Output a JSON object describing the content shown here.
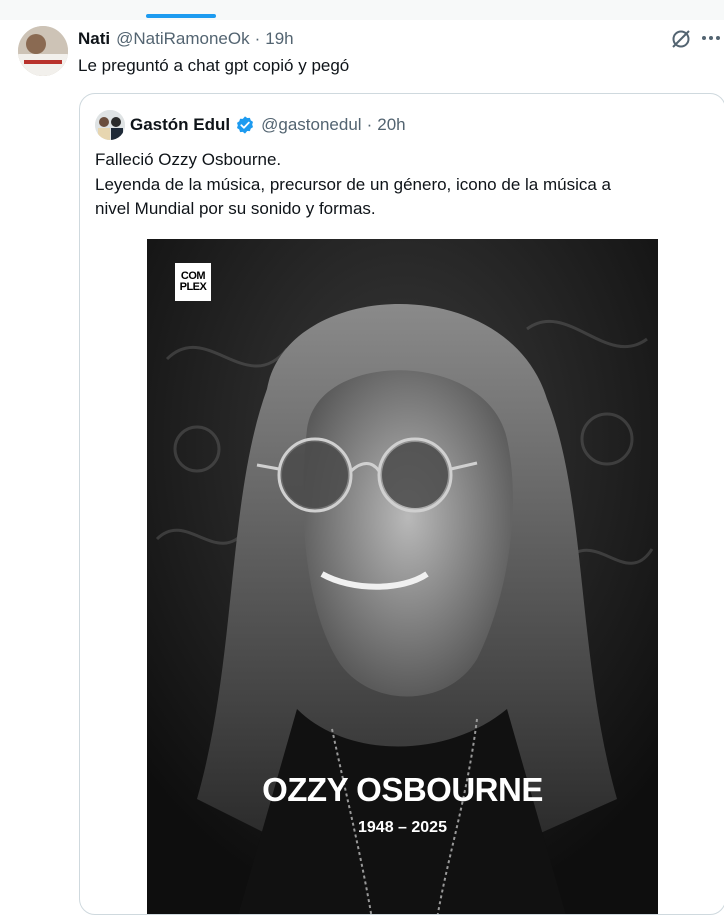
{
  "tweet": {
    "author_name": "Nati",
    "author_handle": "@NatiRamoneOk",
    "separator": "·",
    "time": "19h",
    "text": "Le preguntó a chat gpt copió y pegó",
    "icons": {
      "grok": "grok-icon",
      "more": "more-icon"
    }
  },
  "quote": {
    "author_name": "Gastón Edul",
    "author_handle": "@gastonedul",
    "separator": "·",
    "time": "20h",
    "verified_color": "#1d9bf0",
    "text_lines": [
      "Falleció Ozzy Osbourne.",
      "Leyenda de la música, precursor de un género, icono de la música a",
      "nivel Mundial por su sonido y formas."
    ]
  },
  "media": {
    "logo_line1": "COM",
    "logo_line2": "PLEX",
    "title": "OZZY OSBOURNE",
    "years": "1948 – 2025"
  },
  "colors": {
    "accent": "#1d9bf0",
    "muted": "#536471",
    "border": "#cfd9de"
  }
}
